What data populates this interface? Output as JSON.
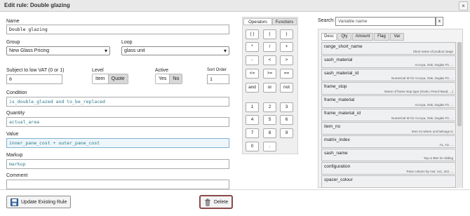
{
  "window": {
    "title": "Edit rule: Double glazing",
    "close_glyph": "×"
  },
  "form": {
    "name_label": "Name",
    "name_value": "Double glazing",
    "group_label": "Group",
    "group_value": "New Glass Pricing",
    "loop_label": "Loop",
    "loop_value": "glass unit",
    "vat_label": "Subject to low VAT (0 or 1)",
    "vat_value": "0",
    "level_label": "Level",
    "level_options": [
      "Item",
      "Quote"
    ],
    "active_label": "Active",
    "active_options": [
      "Yes",
      "No"
    ],
    "sort_label": "Sort Order",
    "sort_value": "1",
    "condition_label": "Condition",
    "condition_value": "is_double_glazed and to_be_replaced",
    "quantity_label": "Quantity",
    "quantity_value": "actual_area",
    "value_label": "Value",
    "value_value": "inner_pane_cost + outer_pane_cost",
    "markup_label": "Markup",
    "markup_value": "markup",
    "comment_label": "Comment",
    "comment_value": ""
  },
  "calculator": {
    "tabs": [
      "Operators",
      "Functions"
    ],
    "operator_keys": [
      "( )",
      "(",
      ")",
      "*",
      "/",
      "+",
      "-",
      "<",
      ">",
      "<=",
      ">=",
      "==",
      "and",
      "or",
      "not"
    ],
    "number_keys": [
      "1",
      "2",
      "3",
      "4",
      "5",
      "6",
      "7",
      "8",
      "9",
      "0",
      "."
    ]
  },
  "variables": {
    "search_label": "Search:",
    "search_placeholder": "Variable name",
    "search_clear": "x",
    "tabs": [
      "Desc",
      "Qty",
      "Amount",
      "Flag",
      "Var"
    ],
    "items": [
      {
        "name": "range_short_name",
        "desc": "Short name of product range"
      },
      {
        "name": "sash_material",
        "desc": "Accoya, Oak, Duglas Fir, ..."
      },
      {
        "name": "sash_material_id",
        "desc": "Numerical ID for Accoya, Oak, Duglas Fir, ..."
      },
      {
        "name": "frame_stop",
        "desc": "Name of frame stop type (Ovolo, Pencil Bead, ...)"
      },
      {
        "name": "frame_material",
        "desc": "Accoya, Oak, Duglas Fir, ..."
      },
      {
        "name": "frame_material_id",
        "desc": "Numerical ID for Accoya, Oak, Duglas Fir, ..."
      },
      {
        "name": "item_no",
        "desc": "Item no where unit belongs to"
      },
      {
        "name": "matrix_index",
        "desc": "A1, A2, ..."
      },
      {
        "name": "sash_name",
        "desc": "Top or Btm for sliding"
      },
      {
        "name": "configuration",
        "desc": "Pane column by row: 1x1, 2x3, ..."
      },
      {
        "name": "spacer_colour",
        "desc": ""
      }
    ]
  },
  "footer": {
    "update_label": "Update Existing Rule",
    "delete_label": "Delete",
    "update_icon": "floppy-disk-icon",
    "delete_icon": "trash-icon"
  }
}
